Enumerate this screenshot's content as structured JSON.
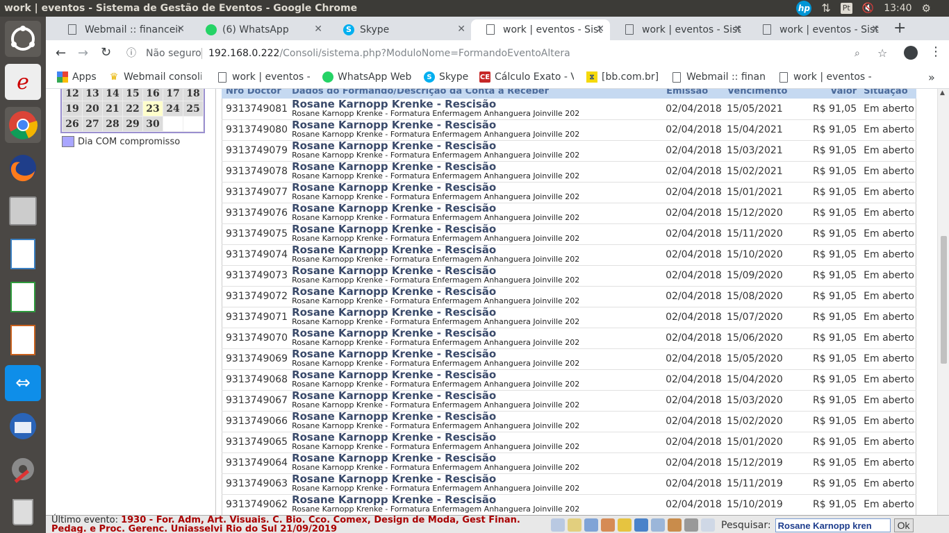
{
  "system": {
    "window_title": "work | eventos - Sistema de Gestão de Eventos - Google Chrome",
    "time": "13:40",
    "keyboard_layout": "Pt",
    "hp_label": "hp"
  },
  "tabs": [
    {
      "title": "Webmail :: financeir",
      "icon": "document-icon",
      "active": false
    },
    {
      "title": "(6) WhatsApp",
      "icon": "whatsapp-icon",
      "active": false
    },
    {
      "title": "Skype",
      "icon": "skype-icon",
      "active": false
    },
    {
      "title": "work | eventos - Sist",
      "icon": "document-icon",
      "active": true
    },
    {
      "title": "work | eventos - Sist",
      "icon": "document-icon",
      "active": false
    },
    {
      "title": "work | eventos - Sist",
      "icon": "document-icon",
      "active": false
    }
  ],
  "address": {
    "security": "Não seguro",
    "host": "192.168.0.222",
    "path": "/Consoli/sistema.php?ModuloNome=FormandoEventoAltera"
  },
  "bookmarks": [
    {
      "label": "Apps",
      "icon": "apps-grid-icon"
    },
    {
      "label": "Webmail consoli",
      "icon": "crown-icon"
    },
    {
      "label": "work | eventos - ",
      "icon": "document-icon"
    },
    {
      "label": "WhatsApp Web",
      "icon": "whatsapp-icon"
    },
    {
      "label": "Skype",
      "icon": "skype-icon"
    },
    {
      "label": "Cálculo Exato - V",
      "icon": "ce-icon"
    },
    {
      "label": "[bb.com.br]",
      "icon": "bb-icon"
    },
    {
      "label": "Webmail :: finan",
      "icon": "document-icon"
    },
    {
      "label": "work | eventos - ",
      "icon": "document-icon"
    }
  ],
  "calendar": {
    "rows": [
      [
        "12",
        "13",
        "14",
        "15",
        "16",
        "17",
        "18"
      ],
      [
        "19",
        "20",
        "21",
        "22",
        "23",
        "24",
        "25"
      ],
      [
        "26",
        "27",
        "28",
        "29",
        "30",
        "",
        ""
      ]
    ],
    "today": "23",
    "legend": "Dia COM compromisso"
  },
  "table": {
    "headers": [
      "Nro Doctor",
      "Dados do Formando/Descrição da Conta a Receber",
      "Emissão",
      "Vencimento",
      "Valor",
      "Situação"
    ],
    "rows": [
      {
        "num": "9313749081",
        "title": "Rosane Karnopp Krenke - Rescisão",
        "desc": "Rosane Karnopp Krenke - Formatura Enfermagem Anhanguera Joinville 202",
        "emissao": "02/04/2018",
        "vencimento": "15/05/2021",
        "valor": "R$ 91,05",
        "situacao": "Em aberto"
      },
      {
        "num": "9313749080",
        "title": "Rosane Karnopp Krenke - Rescisão",
        "desc": "Rosane Karnopp Krenke - Formatura Enfermagem Anhanguera Joinville 202",
        "emissao": "02/04/2018",
        "vencimento": "15/04/2021",
        "valor": "R$ 91,05",
        "situacao": "Em aberto"
      },
      {
        "num": "9313749079",
        "title": "Rosane Karnopp Krenke - Rescisão",
        "desc": "Rosane Karnopp Krenke - Formatura Enfermagem Anhanguera Joinville 202",
        "emissao": "02/04/2018",
        "vencimento": "15/03/2021",
        "valor": "R$ 91,05",
        "situacao": "Em aberto"
      },
      {
        "num": "9313749078",
        "title": "Rosane Karnopp Krenke - Rescisão",
        "desc": "Rosane Karnopp Krenke - Formatura Enfermagem Anhanguera Joinville 202",
        "emissao": "02/04/2018",
        "vencimento": "15/02/2021",
        "valor": "R$ 91,05",
        "situacao": "Em aberto"
      },
      {
        "num": "9313749077",
        "title": "Rosane Karnopp Krenke - Rescisão",
        "desc": "Rosane Karnopp Krenke - Formatura Enfermagem Anhanguera Joinville 202",
        "emissao": "02/04/2018",
        "vencimento": "15/01/2021",
        "valor": "R$ 91,05",
        "situacao": "Em aberto"
      },
      {
        "num": "9313749076",
        "title": "Rosane Karnopp Krenke - Rescisão",
        "desc": "Rosane Karnopp Krenke - Formatura Enfermagem Anhanguera Joinville 202",
        "emissao": "02/04/2018",
        "vencimento": "15/12/2020",
        "valor": "R$ 91,05",
        "situacao": "Em aberto"
      },
      {
        "num": "9313749075",
        "title": "Rosane Karnopp Krenke - Rescisão",
        "desc": "Rosane Karnopp Krenke - Formatura Enfermagem Anhanguera Joinville 202",
        "emissao": "02/04/2018",
        "vencimento": "15/11/2020",
        "valor": "R$ 91,05",
        "situacao": "Em aberto"
      },
      {
        "num": "9313749074",
        "title": "Rosane Karnopp Krenke - Rescisão",
        "desc": "Rosane Karnopp Krenke - Formatura Enfermagem Anhanguera Joinville 202",
        "emissao": "02/04/2018",
        "vencimento": "15/10/2020",
        "valor": "R$ 91,05",
        "situacao": "Em aberto"
      },
      {
        "num": "9313749073",
        "title": "Rosane Karnopp Krenke - Rescisão",
        "desc": "Rosane Karnopp Krenke - Formatura Enfermagem Anhanguera Joinville 202",
        "emissao": "02/04/2018",
        "vencimento": "15/09/2020",
        "valor": "R$ 91,05",
        "situacao": "Em aberto"
      },
      {
        "num": "9313749072",
        "title": "Rosane Karnopp Krenke - Rescisão",
        "desc": "Rosane Karnopp Krenke - Formatura Enfermagem Anhanguera Joinville 202",
        "emissao": "02/04/2018",
        "vencimento": "15/08/2020",
        "valor": "R$ 91,05",
        "situacao": "Em aberto"
      },
      {
        "num": "9313749071",
        "title": "Rosane Karnopp Krenke - Rescisão",
        "desc": "Rosane Karnopp Krenke - Formatura Enfermagem Anhanguera Joinville 202",
        "emissao": "02/04/2018",
        "vencimento": "15/07/2020",
        "valor": "R$ 91,05",
        "situacao": "Em aberto"
      },
      {
        "num": "9313749070",
        "title": "Rosane Karnopp Krenke - Rescisão",
        "desc": "Rosane Karnopp Krenke - Formatura Enfermagem Anhanguera Joinville 202",
        "emissao": "02/04/2018",
        "vencimento": "15/06/2020",
        "valor": "R$ 91,05",
        "situacao": "Em aberto"
      },
      {
        "num": "9313749069",
        "title": "Rosane Karnopp Krenke - Rescisão",
        "desc": "Rosane Karnopp Krenke - Formatura Enfermagem Anhanguera Joinville 202",
        "emissao": "02/04/2018",
        "vencimento": "15/05/2020",
        "valor": "R$ 91,05",
        "situacao": "Em aberto"
      },
      {
        "num": "9313749068",
        "title": "Rosane Karnopp Krenke - Rescisão",
        "desc": "Rosane Karnopp Krenke - Formatura Enfermagem Anhanguera Joinville 202",
        "emissao": "02/04/2018",
        "vencimento": "15/04/2020",
        "valor": "R$ 91,05",
        "situacao": "Em aberto"
      },
      {
        "num": "9313749067",
        "title": "Rosane Karnopp Krenke - Rescisão",
        "desc": "Rosane Karnopp Krenke - Formatura Enfermagem Anhanguera Joinville 202",
        "emissao": "02/04/2018",
        "vencimento": "15/03/2020",
        "valor": "R$ 91,05",
        "situacao": "Em aberto"
      },
      {
        "num": "9313749066",
        "title": "Rosane Karnopp Krenke - Rescisão",
        "desc": "Rosane Karnopp Krenke - Formatura Enfermagem Anhanguera Joinville 202",
        "emissao": "02/04/2018",
        "vencimento": "15/02/2020",
        "valor": "R$ 91,05",
        "situacao": "Em aberto"
      },
      {
        "num": "9313749065",
        "title": "Rosane Karnopp Krenke - Rescisão",
        "desc": "Rosane Karnopp Krenke - Formatura Enfermagem Anhanguera Joinville 202",
        "emissao": "02/04/2018",
        "vencimento": "15/01/2020",
        "valor": "R$ 91,05",
        "situacao": "Em aberto"
      },
      {
        "num": "9313749064",
        "title": "Rosane Karnopp Krenke - Rescisão",
        "desc": "Rosane Karnopp Krenke - Formatura Enfermagem Anhanguera Joinville 202",
        "emissao": "02/04/2018",
        "vencimento": "15/12/2019",
        "valor": "R$ 91,05",
        "situacao": "Em aberto"
      },
      {
        "num": "9313749063",
        "title": "Rosane Karnopp Krenke - Rescisão",
        "desc": "Rosane Karnopp Krenke - Formatura Enfermagem Anhanguera Joinville 202",
        "emissao": "02/04/2018",
        "vencimento": "15/11/2019",
        "valor": "R$ 91,05",
        "situacao": "Em aberto"
      },
      {
        "num": "9313749062",
        "title": "Rosane Karnopp Krenke - Rescisão",
        "desc": "Rosane Karnopp Krenke - Formatura Enfermagem Anhanguera Joinville 202",
        "emissao": "02/04/2018",
        "vencimento": "15/10/2019",
        "valor": "R$ 91,05",
        "situacao": "Em aberto"
      }
    ]
  },
  "status": {
    "last_event_label": "Último evento:",
    "last_event_text": "1930 - For. Adm, Art. Visuais. C. Bio. Cco. Comex, Design de Moda, Gest Finan. Pedag. e Proc. Gerenc. Uniasselvi Rio do Sul 21/09/2019",
    "search_label": "Pesquisar:",
    "search_value": "Rosane Karnopp kren",
    "ok_label": "Ok"
  }
}
